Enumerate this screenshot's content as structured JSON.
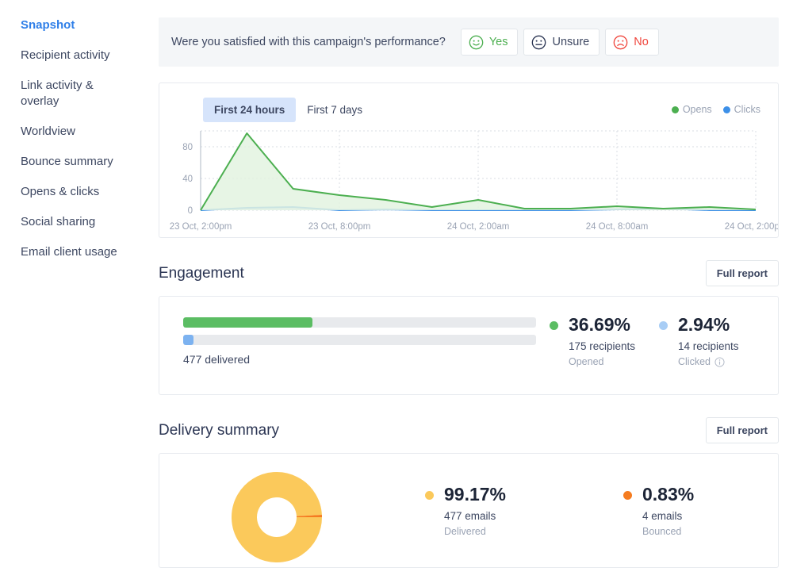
{
  "sidebar": {
    "items": [
      {
        "label": "Snapshot",
        "active": true
      },
      {
        "label": "Recipient activity",
        "active": false
      },
      {
        "label": "Link activity & overlay",
        "active": false
      },
      {
        "label": "Worldview",
        "active": false
      },
      {
        "label": "Bounce summary",
        "active": false
      },
      {
        "label": "Opens & clicks",
        "active": false
      },
      {
        "label": "Social sharing",
        "active": false
      },
      {
        "label": "Email client usage",
        "active": false
      }
    ]
  },
  "survey": {
    "question": "Were you satisfied with this campaign's performance?",
    "options": [
      {
        "label": "Yes",
        "icon": "smiley-face-icon",
        "color": "#4caf50"
      },
      {
        "label": "Unsure",
        "icon": "neutral-face-icon",
        "color": "#2b3553"
      },
      {
        "label": "No",
        "icon": "frown-face-icon",
        "color": "#f0473e"
      }
    ]
  },
  "activity_chart": {
    "tabs": [
      {
        "label": "First 24 hours",
        "active": true
      },
      {
        "label": "First 7 days",
        "active": false
      }
    ],
    "legend": [
      {
        "label": "Opens",
        "color": "#4caf50"
      },
      {
        "label": "Clicks",
        "color": "#3d90e8"
      }
    ]
  },
  "chart_data": {
    "type": "line",
    "title": "",
    "xlabel": "",
    "ylabel": "",
    "ylim": [
      0,
      100
    ],
    "yticks": [
      0,
      40,
      80
    ],
    "grid": true,
    "legend_position": "top-right",
    "x_tick_labels": [
      "23 Oct, 2:00pm",
      "23 Oct, 8:00pm",
      "24 Oct, 2:00am",
      "24 Oct, 8:00am",
      "24 Oct, 2:00pm"
    ],
    "x": [
      "23 Oct, 2:00pm",
      "23 Oct, 4:00pm",
      "23 Oct, 6:00pm",
      "23 Oct, 8:00pm",
      "23 Oct, 10:00pm",
      "24 Oct, 12:00am",
      "24 Oct, 2:00am",
      "24 Oct, 4:00am",
      "24 Oct, 6:00am",
      "24 Oct, 8:00am",
      "24 Oct, 10:00am",
      "24 Oct, 12:00pm",
      "24 Oct, 2:00pm"
    ],
    "series": [
      {
        "name": "Opens",
        "color": "#4caf50",
        "fill": "#e3f3e0",
        "values": [
          0,
          97,
          27,
          19,
          13,
          4,
          13,
          2,
          2,
          5,
          2,
          4,
          1
        ]
      },
      {
        "name": "Clicks",
        "color": "#3d90e8",
        "fill": "#dbe9fa",
        "values": [
          0,
          3,
          4,
          0,
          1,
          0,
          0,
          0,
          0,
          1,
          2,
          0,
          0
        ]
      }
    ]
  },
  "engagement": {
    "title": "Engagement",
    "full_report_label": "Full report",
    "delivered_label": "477 delivered",
    "bars": [
      {
        "name": "opened",
        "percent": 36.69,
        "color": "#5bbd63"
      },
      {
        "name": "clicked",
        "percent": 2.94,
        "color": "#7cb2f0"
      }
    ],
    "metrics": [
      {
        "percent": "36.69%",
        "recipients": "175 recipients",
        "caption": "Opened",
        "color": "#5bbd63",
        "info": false
      },
      {
        "percent": "2.94%",
        "recipients": "14 recipients",
        "caption": "Clicked",
        "color": "#a8cdf5",
        "info": true,
        "info_icon": "info-circle-icon"
      }
    ]
  },
  "delivery": {
    "title": "Delivery summary",
    "full_report_label": "Full report",
    "donut": [
      {
        "name": "Delivered",
        "percent": 99.17,
        "color": "#fbc95b"
      },
      {
        "name": "Bounced",
        "percent": 0.83,
        "color": "#f57c20"
      }
    ],
    "metrics": [
      {
        "percent": "99.17%",
        "emails": "477 emails",
        "caption": "Delivered",
        "color": "#fbc95b"
      },
      {
        "percent": "0.83%",
        "emails": "4 emails",
        "caption": "Bounced",
        "color": "#f57c20"
      }
    ]
  }
}
